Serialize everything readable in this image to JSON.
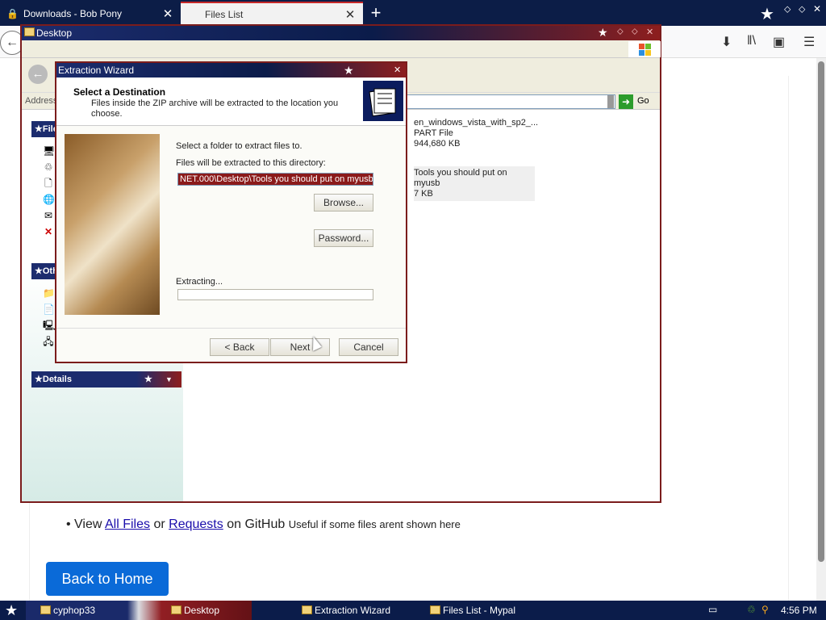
{
  "browser": {
    "tabs": [
      {
        "label": "Downloads - Bob Pony",
        "close": "✕"
      },
      {
        "label": "Files List",
        "close": "✕"
      }
    ],
    "new_tab": "+",
    "toolbar_icons": [
      "download-icon",
      "library-icon",
      "sidebar-icon",
      "menu-icon"
    ]
  },
  "webpage": {
    "bullet": {
      "prefix": "View",
      "link1": "All Files",
      "or": "or",
      "link2": "Requests",
      "suffix": "on GitHub",
      "note": "Useful if some files arent shown here"
    },
    "back_home": "Back to Home"
  },
  "explorer": {
    "title": "Desktop",
    "address_label": "Address",
    "go_label": "Go",
    "side_panels": [
      {
        "label": "File"
      },
      {
        "label": "Oth"
      },
      {
        "label": "Details"
      }
    ],
    "files": [
      {
        "name": "en_windows_vista_with_sp2_...",
        "type": "PART File",
        "size": "944,680 KB"
      },
      {
        "name": "Tools you should put on myusb",
        "size": "7 KB"
      }
    ]
  },
  "wizard": {
    "title": "Extraction Wizard",
    "header_title": "Select a Destination",
    "header_desc": "Files inside the ZIP archive will be extracted to the location you choose.",
    "instruction": "Select a folder to extract files to.",
    "dir_label": "Files will be extracted to this directory:",
    "dir_value": "NET.000\\Desktop\\Tools you should put on myusb",
    "browse": "Browse...",
    "password": "Password...",
    "extracting": "Extracting...",
    "progress": 0,
    "back": "< Back",
    "next": "Next",
    "cancel": "Cancel"
  },
  "taskbar": {
    "items": [
      "cyphop33",
      "Desktop",
      "Extraction Wizard",
      "Files List - Mypal"
    ],
    "clock": "4:56 PM"
  },
  "colors": {
    "titlebar_navy": "#1c2c6e",
    "titlebar_red": "#8d1e1e",
    "link": "#1a0dab",
    "home_button": "#0a6ad8",
    "selection": "#8b1a1a"
  }
}
